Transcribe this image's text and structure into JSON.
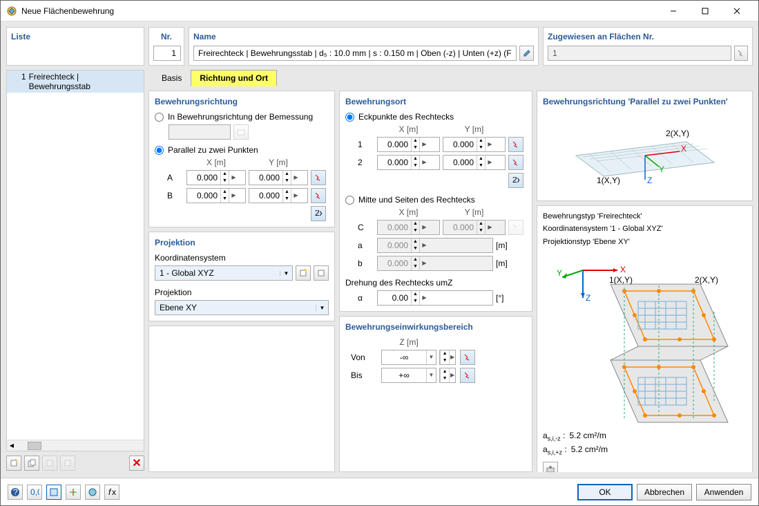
{
  "window": {
    "title": "Neue Flächenbewehrung"
  },
  "top": {
    "list_head": "Liste",
    "list_item_num": "1",
    "list_item_text": "Freirechteck | Bewehrungsstab",
    "nr_head": "Nr.",
    "nr_value": "1",
    "name_head": "Name",
    "name_value": "Freirechteck | Bewehrungsstab | d₅ : 10.0 mm | s : 0.150 m | Oben (-z) | Unten (+z) (Fläc",
    "assigned_head": "Zugewiesen an Flächen Nr.",
    "assigned_value": "1"
  },
  "tabs": {
    "basis": "Basis",
    "richtung": "Richtung und Ort"
  },
  "g_dir": {
    "title": "Bewehrungsrichtung",
    "r1": "In Bewehrungsrichtung der Bemessung",
    "r2": "Parallel zu zwei Punkten",
    "X": "X [m]",
    "Y": "Y [m]",
    "A": "A",
    "B": "B",
    "val": "0.000"
  },
  "g_proj": {
    "title": "Projektion",
    "coord_label": "Koordinatensystem",
    "coord_value": "1 - Global XYZ",
    "proj_label": "Projektion",
    "proj_value": "Ebene XY"
  },
  "g_ort": {
    "title": "Bewehrungsort",
    "r1": "Eckpunkte des Rechtecks",
    "r2": "Mitte und Seiten des Rechtecks",
    "X": "X [m]",
    "Y": "Y [m]",
    "row1": "1",
    "row2": "2",
    "C": "C",
    "a": "a",
    "b": "b",
    "val": "0.000",
    "m": "[m]",
    "rot_label": "Drehung des Rechtecks umZ",
    "alpha": "α",
    "rot_val": "0.00",
    "deg": "[°]"
  },
  "g_bereich": {
    "title": "Bewehrungseinwirkungsbereich",
    "Z": "Z [m]",
    "von": "Von",
    "bis": "Bis",
    "minf": "-∞",
    "pinf": "+∞"
  },
  "img1": {
    "caption": "Bewehrungsrichtung 'Parallel zu zwei Punkten'"
  },
  "img2": {
    "line1": "Bewehrungstyp 'Freirechteck'",
    "line2": "Koordinatensystem '1 - Global XYZ'",
    "line3": "Projektionstyp 'Ebene XY'",
    "res1_l": "a₅,ᵢ,₋ᵣ :",
    "res1_v": "5.2 cm²/m",
    "res2_l": "a₅,ᵢ,₊ᵣ :",
    "res2_v": "5.2 cm²/m"
  },
  "foot": {
    "ok": "OK",
    "cancel": "Abbrechen",
    "apply": "Anwenden"
  }
}
